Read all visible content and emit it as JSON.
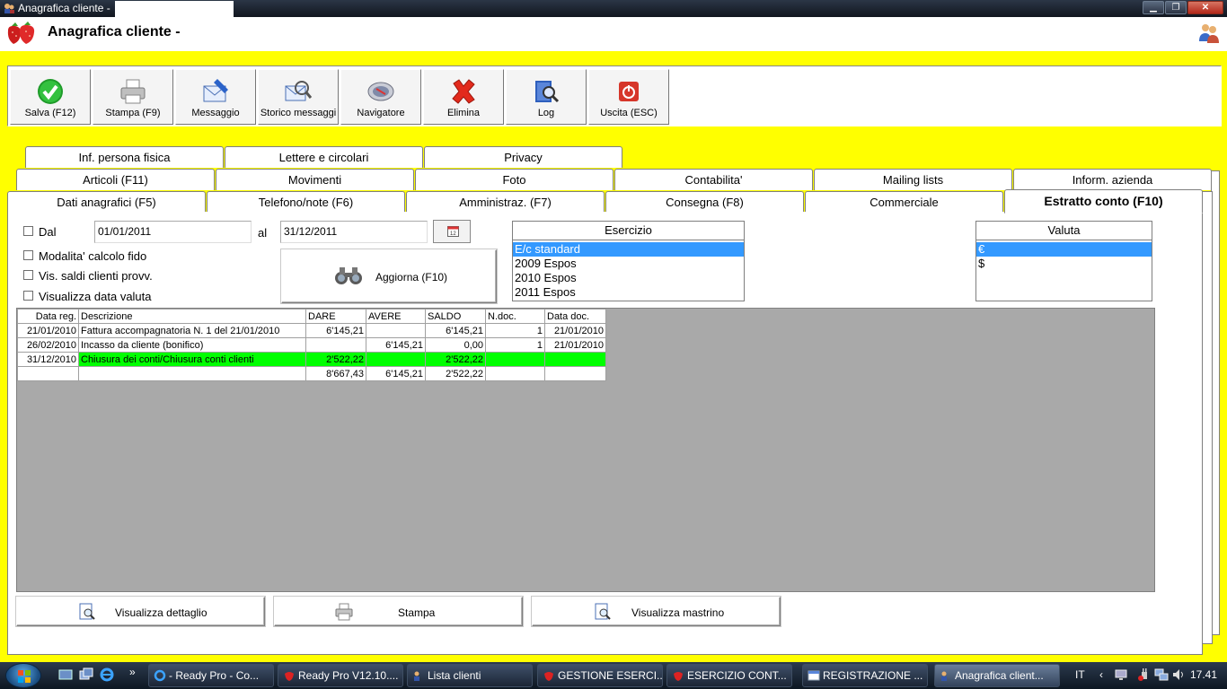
{
  "window": {
    "title": "Anagrafica cliente - "
  },
  "header": {
    "title": "Anagrafica cliente - "
  },
  "toolbar": [
    {
      "label": "Salva (F12)",
      "icon": "check-icon"
    },
    {
      "label": "Stampa (F9)",
      "icon": "printer-icon"
    },
    {
      "label": "Messaggio",
      "icon": "message-icon"
    },
    {
      "label": "Storico messaggi",
      "icon": "message-history-icon"
    },
    {
      "label": "Navigatore",
      "icon": "navigator-icon"
    },
    {
      "label": "Elimina",
      "icon": "delete-icon"
    },
    {
      "label": "Log",
      "icon": "log-icon"
    },
    {
      "label": "Uscita (ESC)",
      "icon": "exit-icon"
    }
  ],
  "tabs": {
    "row1": [
      "Inf. persona fisica",
      "Lettere e circolari",
      "Privacy"
    ],
    "row2": [
      "Articoli (F11)",
      "Movimenti",
      "Foto",
      "Contabilita'",
      "Mailing lists",
      "Inform. azienda"
    ],
    "row3": [
      "Dati anagrafici (F5)",
      "Telefono/note (F6)",
      "Amministraz. (F7)",
      "Consegna (F8)",
      "Commerciale",
      "Estratto conto (F10)"
    ],
    "active": "Estratto conto (F10)"
  },
  "filters": {
    "dal_label": "Dal",
    "dal_value": "01/01/2011",
    "al_label": "al",
    "al_value": "31/12/2011",
    "modalita_label": "Modalita' calcolo fido",
    "vis_saldi_label": "Vis. saldi clienti provv.",
    "visualizza_data_label": "Visualizza data valuta",
    "aggiorna_label": "Aggiorna (F10)"
  },
  "esercizio": {
    "header": "Esercizio",
    "items": [
      "E/c standard",
      "2009 Espos",
      "2010 Espos",
      "2011 Espos"
    ],
    "selected": 0
  },
  "valuta": {
    "header": "Valuta",
    "items": [
      "€",
      "$"
    ],
    "selected": 0
  },
  "grid": {
    "columns": [
      "Data reg.",
      "Descrizione",
      "DARE",
      "AVERE",
      "SALDO",
      "N.doc.",
      "Data doc."
    ],
    "rows": [
      [
        "21/01/2010",
        "Fattura accompagnatoria N. 1 del 21/01/2010",
        "6'145,21",
        "",
        "6'145,21",
        "1",
        "21/01/2010"
      ],
      [
        "26/02/2010",
        "Incasso da cliente (bonifico)",
        "",
        "6'145,21",
        "0,00",
        "1",
        "21/01/2010"
      ],
      [
        "31/12/2010",
        "Chiusura dei conti/Chiusura conti clienti",
        "2'522,22",
        "",
        "2'522,22",
        "",
        ""
      ]
    ],
    "totals": [
      "",
      "",
      "8'667,43",
      "6'145,21",
      "2'522,22",
      "",
      ""
    ],
    "highlight_color": "#00ff00"
  },
  "bottom_buttons": {
    "dettaglio": "Visualizza dettaglio",
    "stampa": "Stampa",
    "mastrino": "Visualizza mastrino"
  },
  "taskbar": {
    "items": [
      "- Ready Pro - Co...",
      "Ready Pro V12.10....",
      "Lista clienti",
      "GESTIONE ESERCI...",
      "ESERCIZIO CONT...",
      "REGISTRAZIONE ...",
      "Anagrafica client..."
    ],
    "lang": "IT",
    "clock": "17.41"
  }
}
